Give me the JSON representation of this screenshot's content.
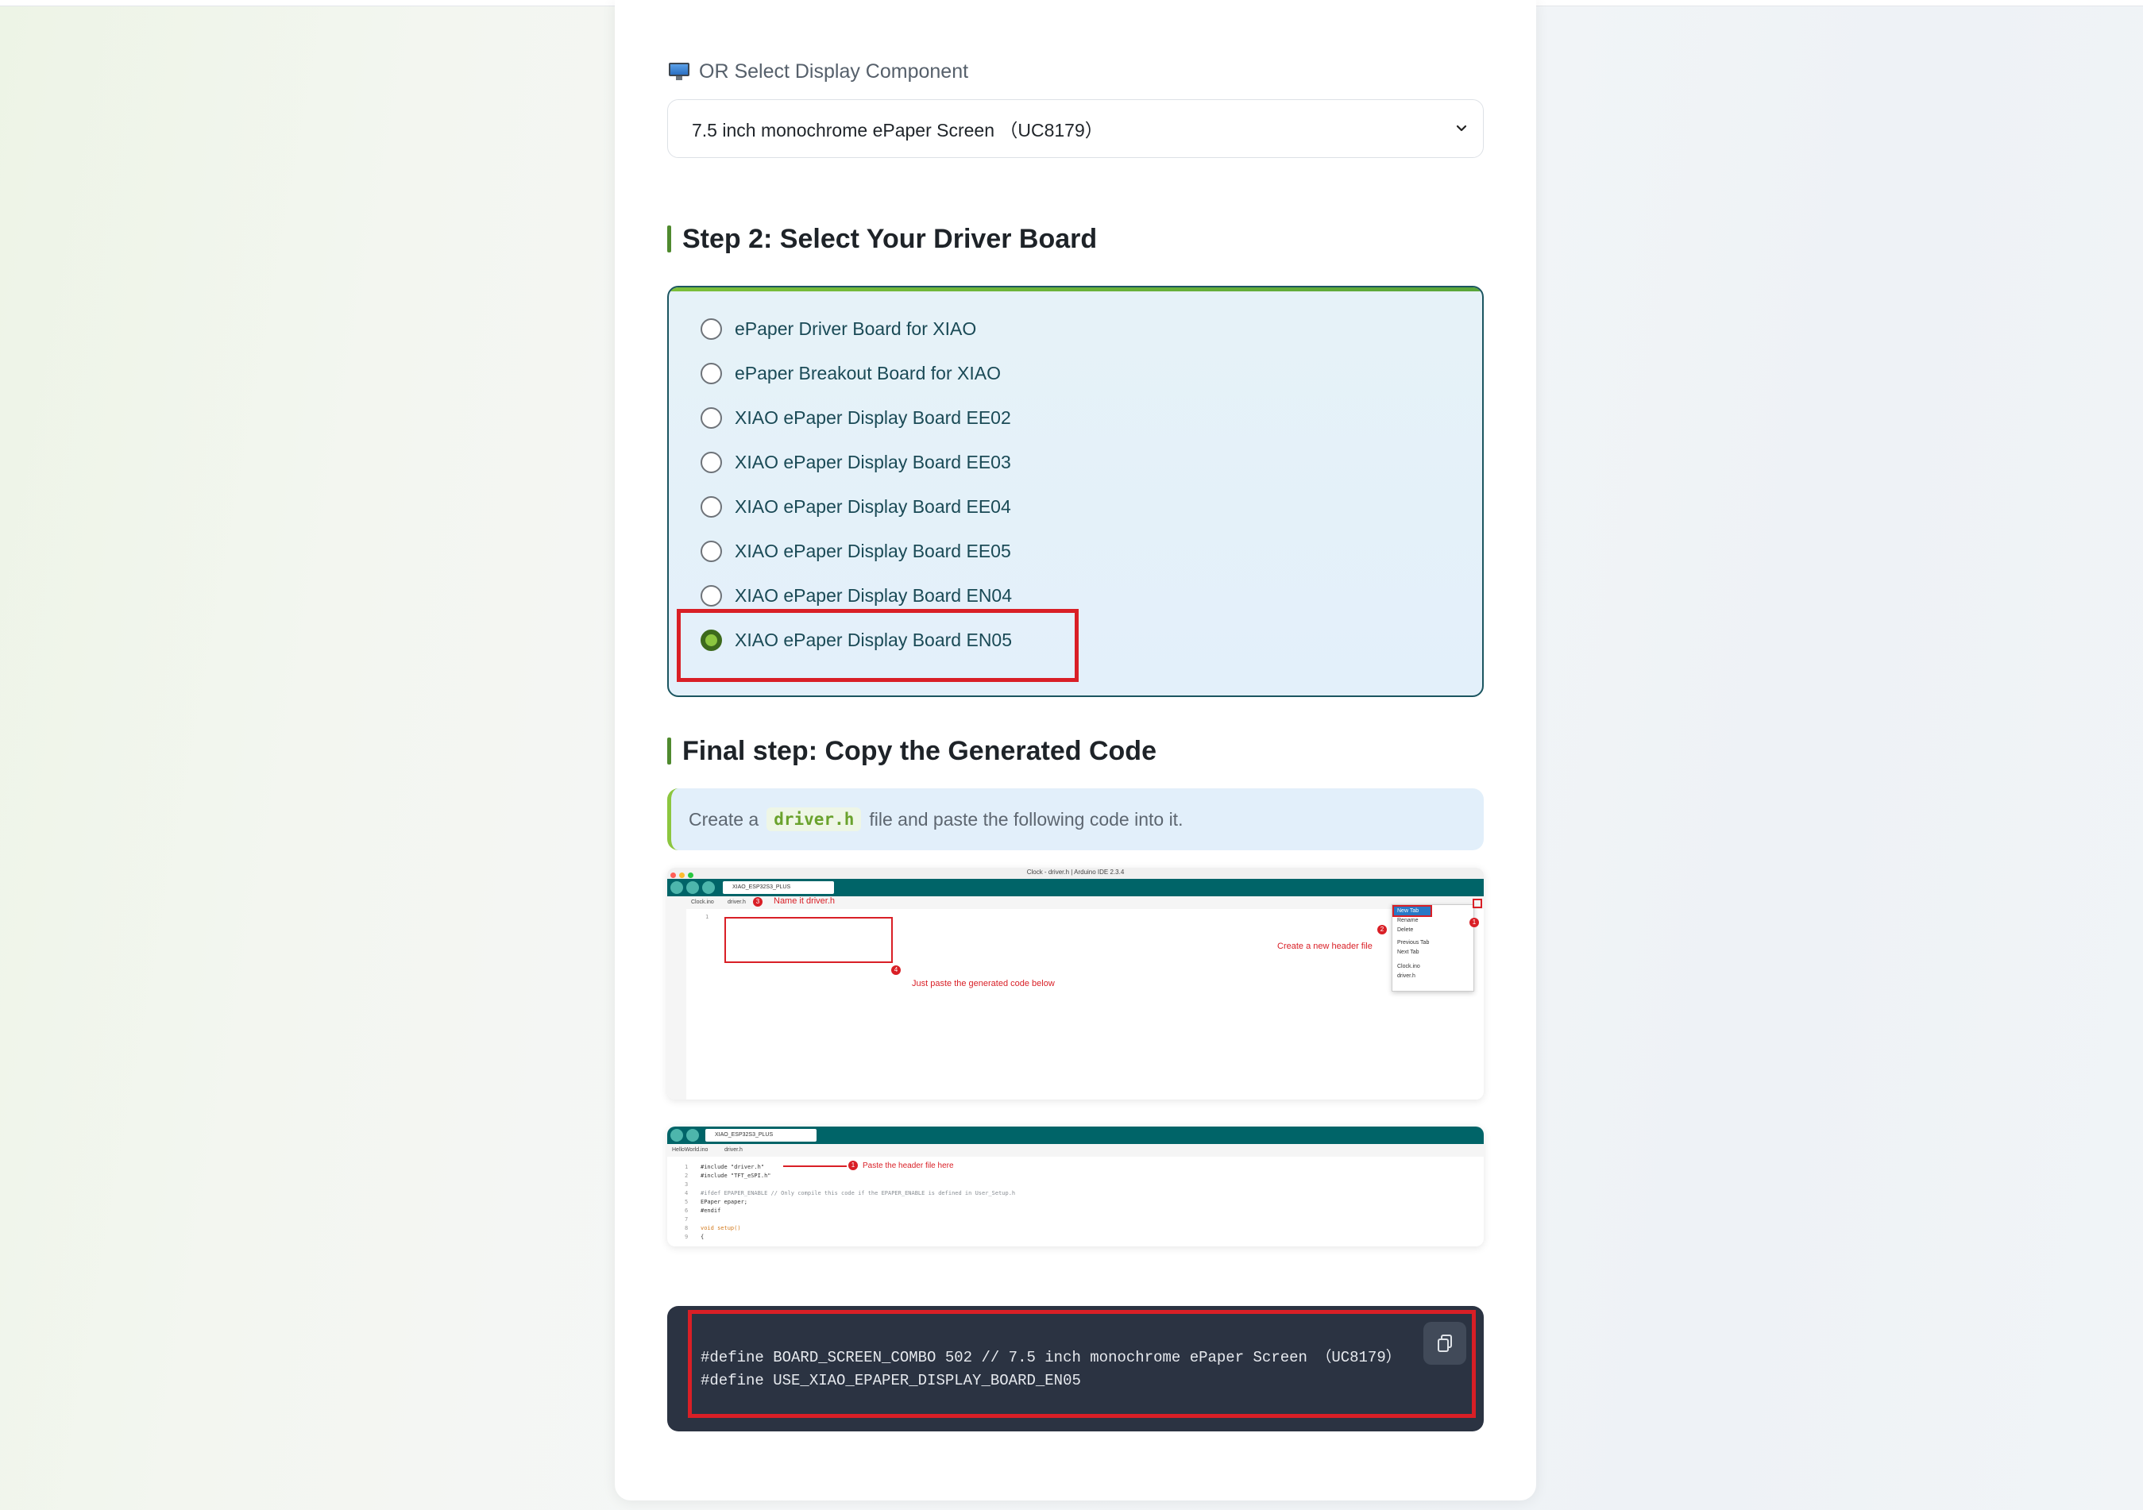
{
  "display": {
    "label": "OR Select Display Component",
    "selected": "7.5 inch monochrome ePaper Screen （UC8179）"
  },
  "step2": {
    "title": "Step 2: Select Your Driver Board",
    "options": [
      {
        "label": "ePaper Driver Board for XIAO",
        "checked": false
      },
      {
        "label": "ePaper Breakout Board for XIAO",
        "checked": false
      },
      {
        "label": "XIAO ePaper Display Board EE02",
        "checked": false
      },
      {
        "label": "XIAO ePaper Display Board EE03",
        "checked": false
      },
      {
        "label": "XIAO ePaper Display Board EE04",
        "checked": false
      },
      {
        "label": "XIAO ePaper Display Board EE05",
        "checked": false
      },
      {
        "label": "XIAO ePaper Display Board EN04",
        "checked": false
      },
      {
        "label": "XIAO ePaper Display Board EN05",
        "checked": true
      }
    ]
  },
  "final": {
    "title": "Final step: Copy the Generated Code",
    "note_before": "Create a",
    "note_code": "driver.h",
    "note_after": "file and paste the following code into it."
  },
  "ide1": {
    "window_title": "Clock - driver.h | Arduino IDE 2.3.4",
    "board": "XIAO_ESP32S3_PLUS",
    "tab1": "Clock.ino",
    "tab2": "driver.h",
    "line_number": "1",
    "ann_name": "Name it driver.h",
    "ann_name_num": "3",
    "ann_create": "Create a new header file",
    "ann_create_num": "2",
    "ann_menu_num": "1",
    "ann_paste": "Just paste the generated code below",
    "ann_paste_num": "4",
    "menu": [
      "New Tab",
      "Rename",
      "Delete",
      "Previous Tab",
      "Next Tab",
      "Clock.ino",
      "driver.h"
    ]
  },
  "ide2": {
    "board": "XIAO_ESP32S3_PLUS",
    "tab1": "HelloWorld.ino",
    "tab2": "driver.h",
    "ann": "Paste the header file here",
    "ann_num": "1",
    "lines": [
      {
        "n": "1",
        "t": "#include \"driver.h\""
      },
      {
        "n": "2",
        "t": "#include \"TFT_eSPI.h\""
      },
      {
        "n": "3",
        "t": ""
      },
      {
        "n": "4",
        "t": "#ifdef EPAPER_ENABLE // Only compile this code if the EPAPER_ENABLE is defined in User_Setup.h"
      },
      {
        "n": "5",
        "t": "EPaper epaper;"
      },
      {
        "n": "6",
        "t": "#endif"
      },
      {
        "n": "7",
        "t": ""
      },
      {
        "n": "8",
        "t": "void setup()"
      },
      {
        "n": "9",
        "t": "{"
      }
    ]
  },
  "code": {
    "line1": "#define BOARD_SCREEN_COMBO 502 // 7.5 inch monochrome ePaper Screen （UC8179）",
    "line2": "#define USE_XIAO_EPAPER_DISPLAY_BOARD_EN05"
  },
  "colors": {
    "accent_green": "#8cc63f",
    "highlight_red": "#d91f26",
    "code_bg": "#2b3342"
  }
}
